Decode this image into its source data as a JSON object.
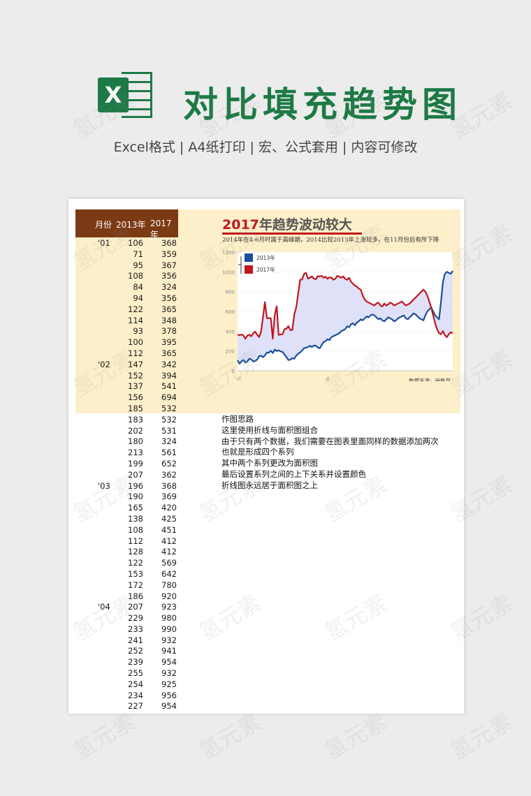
{
  "header": {
    "logo_letter": "X",
    "title": "对比填充趋势图",
    "subtitle": "Excel格式 | A4纸打印 | 宏、公式套用 | 内容可修改"
  },
  "table": {
    "headers": [
      "月份",
      "2013年",
      "2017年"
    ],
    "rows": [
      [
        "'01",
        "106",
        "368"
      ],
      [
        "",
        "71",
        "359"
      ],
      [
        "",
        "95",
        "367"
      ],
      [
        "",
        "108",
        "356"
      ],
      [
        "",
        "84",
        "324"
      ],
      [
        "",
        "94",
        "356"
      ],
      [
        "",
        "122",
        "365"
      ],
      [
        "",
        "114",
        "348"
      ],
      [
        "",
        "93",
        "378"
      ],
      [
        "",
        "100",
        "395"
      ],
      [
        "",
        "112",
        "365"
      ],
      [
        "'02",
        "147",
        "342"
      ],
      [
        "",
        "152",
        "394"
      ],
      [
        "",
        "137",
        "541"
      ],
      [
        "",
        "156",
        "694"
      ],
      [
        "",
        "185",
        "532"
      ],
      [
        "",
        "183",
        "532"
      ],
      [
        "",
        "202",
        "531"
      ],
      [
        "",
        "180",
        "324"
      ],
      [
        "",
        "213",
        "561"
      ],
      [
        "",
        "199",
        "652"
      ],
      [
        "",
        "207",
        "362"
      ],
      [
        "'03",
        "196",
        "368"
      ],
      [
        "",
        "190",
        "369"
      ],
      [
        "",
        "165",
        "420"
      ],
      [
        "",
        "138",
        "425"
      ],
      [
        "",
        "108",
        "451"
      ],
      [
        "",
        "112",
        "412"
      ],
      [
        "",
        "128",
        "412"
      ],
      [
        "",
        "122",
        "569"
      ],
      [
        "",
        "153",
        "642"
      ],
      [
        "",
        "172",
        "780"
      ],
      [
        "",
        "186",
        "920"
      ],
      [
        "'04",
        "207",
        "923"
      ],
      [
        "",
        "229",
        "980"
      ],
      [
        "",
        "233",
        "990"
      ],
      [
        "",
        "241",
        "932"
      ],
      [
        "",
        "252",
        "941"
      ],
      [
        "",
        "239",
        "954"
      ],
      [
        "",
        "255",
        "932"
      ],
      [
        "",
        "254",
        "925"
      ],
      [
        "",
        "234",
        "956"
      ],
      [
        "",
        "227",
        "954"
      ]
    ]
  },
  "chart_title": {
    "year": "2017",
    "rest": "年趋势波动较大"
  },
  "chart_desc": "2014年在4-6月时属于高峰期，2014比较2013年上涨较多，在11月份后有所下降",
  "chart_data": {
    "type": "line",
    "title": "2017年趋势波动较大",
    "subtitle": "2014年在4-6月时属于高峰期，2014比较2013年上涨较多，在11月份后有所下降",
    "ylim": [
      0,
      1200
    ],
    "yticks": [
      "0",
      "200",
      "400",
      "600",
      "800",
      "1000",
      "1200"
    ],
    "xticks": [
      "'01",
      "'06",
      "'1"
    ],
    "source_note": "数据来源：销售部",
    "series": [
      {
        "name": "2013年",
        "color": "#1a4f9c",
        "values": [
          106,
          71,
          95,
          108,
          84,
          94,
          122,
          114,
          93,
          100,
          112,
          147,
          152,
          137,
          156,
          185,
          183,
          202,
          180,
          213,
          199,
          207,
          196,
          190,
          165,
          138,
          108,
          112,
          128,
          122,
          153,
          172,
          186,
          207,
          229,
          233,
          241,
          252,
          239,
          255,
          254,
          234,
          227,
          260,
          290,
          300,
          320,
          310,
          340,
          350,
          360,
          370,
          380,
          400,
          410,
          420,
          450,
          440,
          470,
          480,
          460,
          490,
          500,
          520,
          510,
          530,
          550,
          540,
          560,
          570,
          560,
          540,
          520,
          530,
          510,
          500,
          520,
          540,
          530,
          520,
          500,
          510,
          530,
          540,
          550,
          560,
          530,
          520,
          540,
          560,
          580,
          570,
          550,
          530,
          520,
          510,
          560,
          600,
          620,
          640,
          600,
          560,
          540,
          520,
          700,
          900,
          980,
          1000,
          990,
          980,
          1010
        ]
      },
      {
        "name": "2017年",
        "color": "#c0171d",
        "values": [
          368,
          359,
          367,
          356,
          324,
          356,
          365,
          348,
          378,
          395,
          365,
          342,
          394,
          541,
          694,
          532,
          532,
          531,
          324,
          561,
          652,
          362,
          368,
          369,
          420,
          425,
          451,
          412,
          412,
          569,
          642,
          780,
          920,
          923,
          980,
          990,
          932,
          941,
          954,
          932,
          925,
          956,
          954,
          960,
          940,
          950,
          930,
          945,
          940,
          920,
          930,
          960,
          950,
          940,
          955,
          930,
          920,
          940,
          900,
          880,
          860,
          850,
          830,
          820,
          760,
          720,
          700,
          690,
          680,
          670,
          660,
          680,
          690,
          660,
          650,
          680,
          660,
          670,
          690,
          680,
          660,
          670,
          680,
          690,
          700,
          680,
          660,
          670,
          680,
          700,
          720,
          740,
          760,
          780,
          800,
          820,
          800,
          760,
          700,
          640,
          560,
          480,
          420,
          380,
          370,
          400,
          360,
          340,
          370,
          390,
          380
        ]
      }
    ]
  },
  "notes": {
    "heading": "作图思路",
    "lines": [
      "这里使用折线与面积图组合",
      "由于只有两个数据，我们需要在图表里面同样的数据添加两次",
      "也就是形成四个系列",
      "其中两个系列更改为面积图",
      "最后设置系列之间的上下关系并设置颜色",
      "折线图永远居于面积图之上"
    ]
  },
  "watermark": "氢元素"
}
